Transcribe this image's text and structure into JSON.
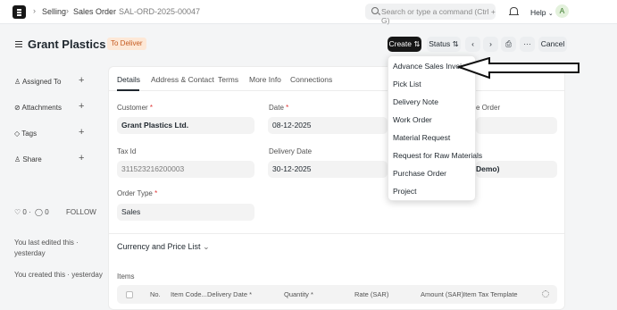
{
  "navbar": {
    "breadcrumbs": [
      "Selling",
      "Sales Order",
      "SAL-ORD-2025-00047"
    ],
    "search_placeholder": "Search or type a command (Ctrl + G)",
    "help_label": "Help",
    "avatar_initial": "A"
  },
  "header": {
    "title": "Grant Plastics Ltd.",
    "status_badge": "To Deliver",
    "create_label": "Create",
    "status_label": "Status",
    "cancel_label": "Cancel",
    "more_label": "···"
  },
  "sidebar": {
    "items": [
      {
        "label": "Assigned To",
        "icon": "user-plus-icon"
      },
      {
        "label": "Attachments",
        "icon": "paperclip-icon"
      },
      {
        "label": "Tags",
        "icon": "tag-icon"
      },
      {
        "label": "Share",
        "icon": "share-icon"
      }
    ],
    "likes": "0",
    "comments": "0",
    "follow_label": "FOLLOW",
    "edited_text": "You last edited this · yesterday",
    "created_text": "You created this · yesterday"
  },
  "tabs": [
    "Details",
    "Address & Contact",
    "Terms",
    "More Info",
    "Connections"
  ],
  "form": {
    "customer": {
      "label": "Customer",
      "value": "Grant Plastics Ltd."
    },
    "date": {
      "label": "Date",
      "value": "08-12-2025"
    },
    "tax_id": {
      "label": "Tax Id",
      "value": "311523216200003"
    },
    "delivery_date": {
      "label": "Delivery Date",
      "value": "30-12-2025"
    },
    "order_type": {
      "label": "Order Type",
      "value": "Sales"
    },
    "partial_label": "e Order",
    "partial_value": "Demo)",
    "required_mark": "*"
  },
  "sections": {
    "currency_title": "Currency and Price List",
    "items_label": "Items"
  },
  "items_table": {
    "columns": [
      "No.",
      "Item Code...",
      "Delivery Date *",
      "Quantity *",
      "Rate (SAR)",
      "Amount (SAR)",
      "Item Tax Template"
    ]
  },
  "create_menu": {
    "items": [
      "Advance Sales Invoice",
      "Pick List",
      "Delivery Note",
      "Work Order",
      "Material Request",
      "Request for Raw Materials",
      "Purchase Order",
      "Project"
    ]
  },
  "colors": {
    "badge_bg": "#fde8d7",
    "badge_text": "#c4591f",
    "primary_button": "#171717"
  }
}
